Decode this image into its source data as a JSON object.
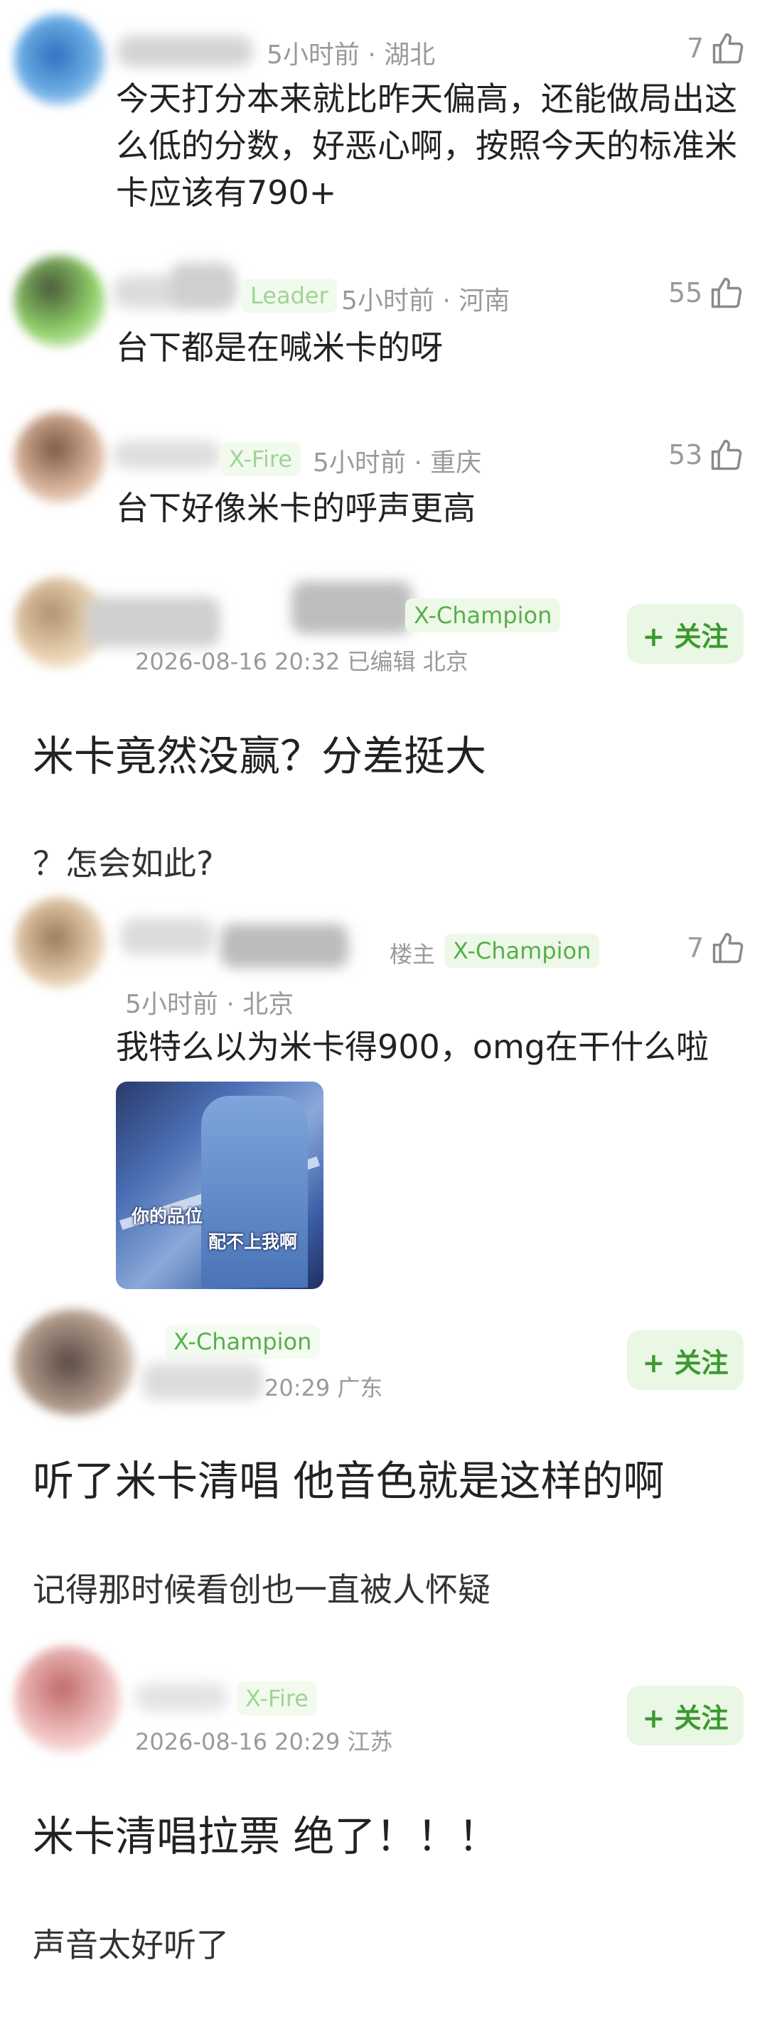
{
  "replies": [
    {
      "meta": "5小时前 · 湖北",
      "likes": "7",
      "text": "今天打分本来就比昨天偏高，还能做局出这么低的分数，好恶心啊，按照今天的标准米卡应该有790+"
    },
    {
      "badge": "Leader",
      "meta": "5小时前 · 河南",
      "likes": "55",
      "text": "台下都是在喊米卡的呀"
    },
    {
      "badge": "X-Fire",
      "meta": "5小时前 · 重庆",
      "likes": "53",
      "text": "台下好像米卡的呼声更高"
    }
  ],
  "posts": [
    {
      "badge": "X-Champion",
      "meta": "2026-08-16 20:32 已编辑 北京",
      "follow": "+ 关注",
      "title": "米卡竟然没赢？分差挺大",
      "body": "？怎会如此?"
    },
    {
      "badge": "X-Champion",
      "meta": "20:29 广东",
      "follow": "+ 关注",
      "title": "听了米卡清唱 他音色就是这样的啊",
      "body": "记得那时候看创也一直被人怀疑"
    },
    {
      "badge": "X-Fire",
      "meta": "2026-08-16 20:29 江苏",
      "follow": "+ 关注",
      "title": "米卡清唱拉票 绝了！！！",
      "body": "声音太好听了"
    }
  ],
  "op_reply": {
    "op_tag": "楼主",
    "badge": "X-Champion",
    "likes": "7",
    "meta": "5小时前 · 北京",
    "text": "我特么以为米卡得900，omg在干什么啦",
    "gif_caption_1": "你的品位",
    "gif_caption_2": "配不上我啊"
  },
  "colors": {
    "accent_green": "#55b04a",
    "badge_bg": "#eef8e8",
    "follow_bg": "#eaf7e4",
    "meta_gray": "#9a9a9a"
  },
  "icons": {
    "like": "thumbs-up-icon"
  }
}
